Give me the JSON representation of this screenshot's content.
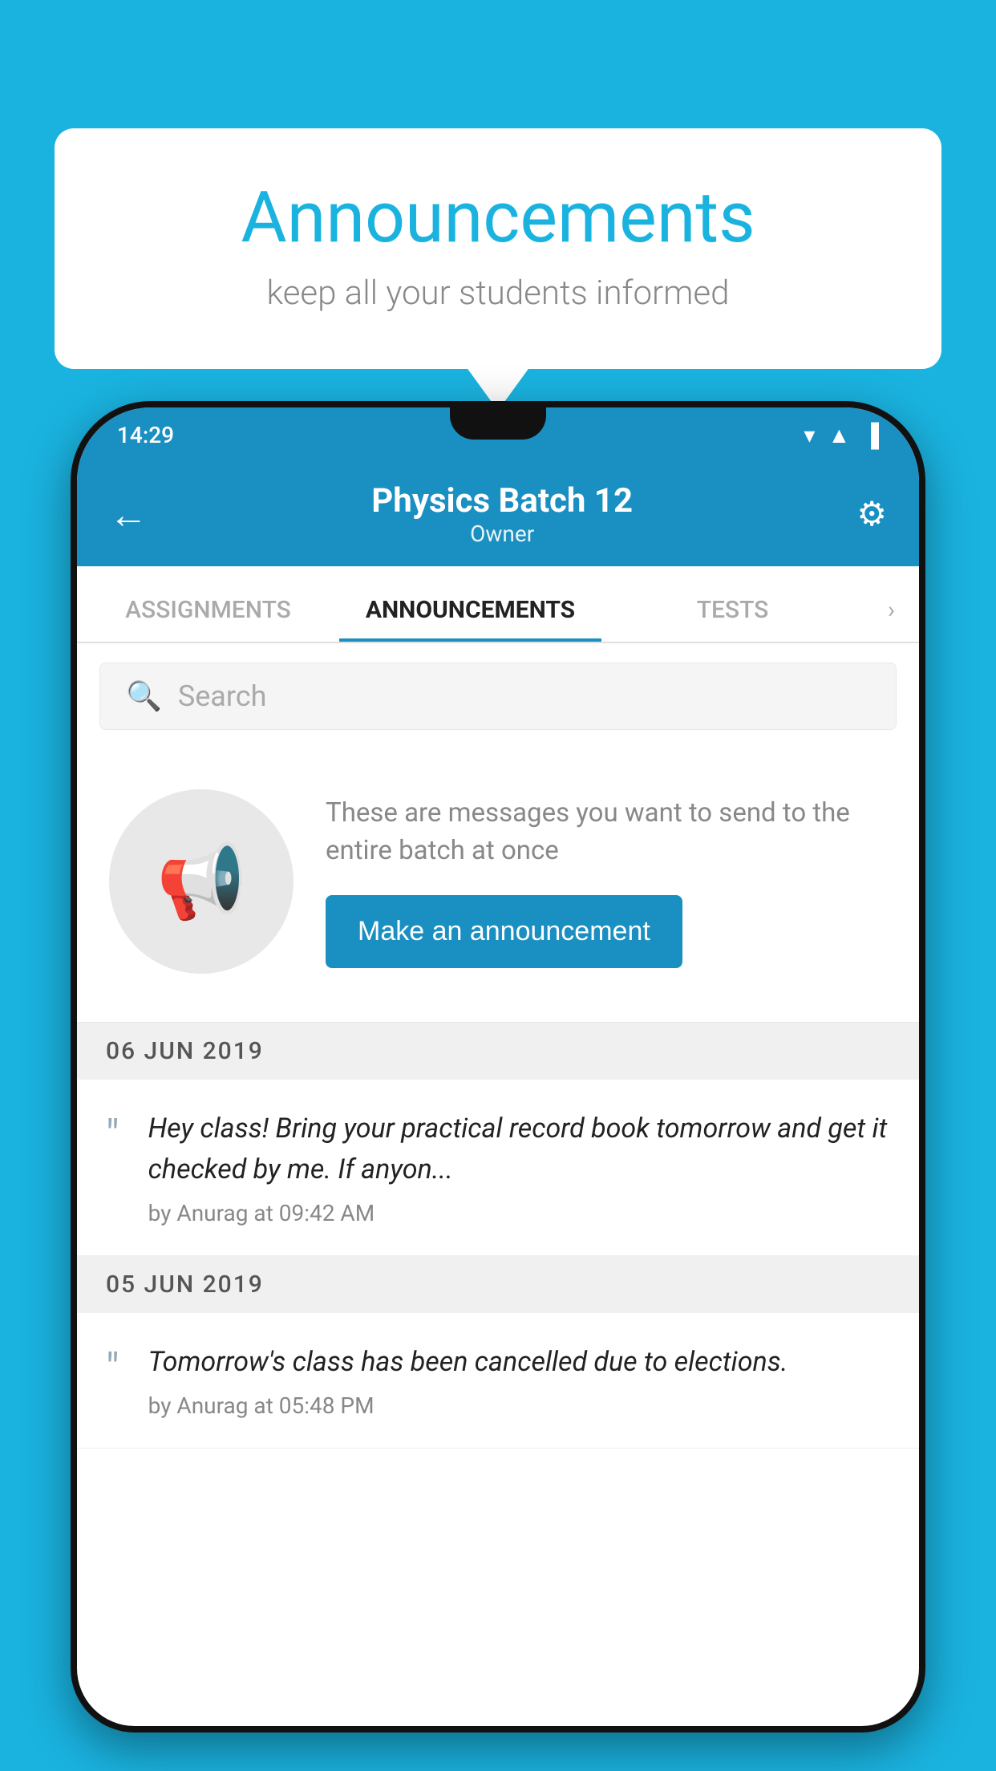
{
  "background_color": "#1ab3e0",
  "speech_bubble": {
    "title": "Announcements",
    "subtitle": "keep all your students informed"
  },
  "phone": {
    "status_bar": {
      "time": "14:29",
      "wifi_icon": "wifi-icon",
      "signal_icon": "signal-icon",
      "battery_icon": "battery-icon"
    },
    "header": {
      "back_label": "←",
      "title": "Physics Batch 12",
      "subtitle": "Owner",
      "settings_icon": "gear-icon"
    },
    "tabs": [
      {
        "label": "ASSIGNMENTS",
        "active": false
      },
      {
        "label": "ANNOUNCEMENTS",
        "active": true
      },
      {
        "label": "TESTS",
        "active": false
      },
      {
        "label": "›",
        "active": false
      }
    ],
    "search": {
      "placeholder": "Search"
    },
    "announcement_prompt": {
      "description": "These are messages you want to send to the entire batch at once",
      "button_label": "Make an announcement"
    },
    "date_groups": [
      {
        "date": "06  JUN  2019",
        "announcements": [
          {
            "text": "Hey class! Bring your practical record book tomorrow and get it checked by me. If anyon...",
            "meta": "by Anurag at 09:42 AM"
          }
        ]
      },
      {
        "date": "05  JUN  2019",
        "announcements": [
          {
            "text": "Tomorrow's class has been cancelled due to elections.",
            "meta": "by Anurag at 05:48 PM"
          }
        ]
      }
    ]
  }
}
